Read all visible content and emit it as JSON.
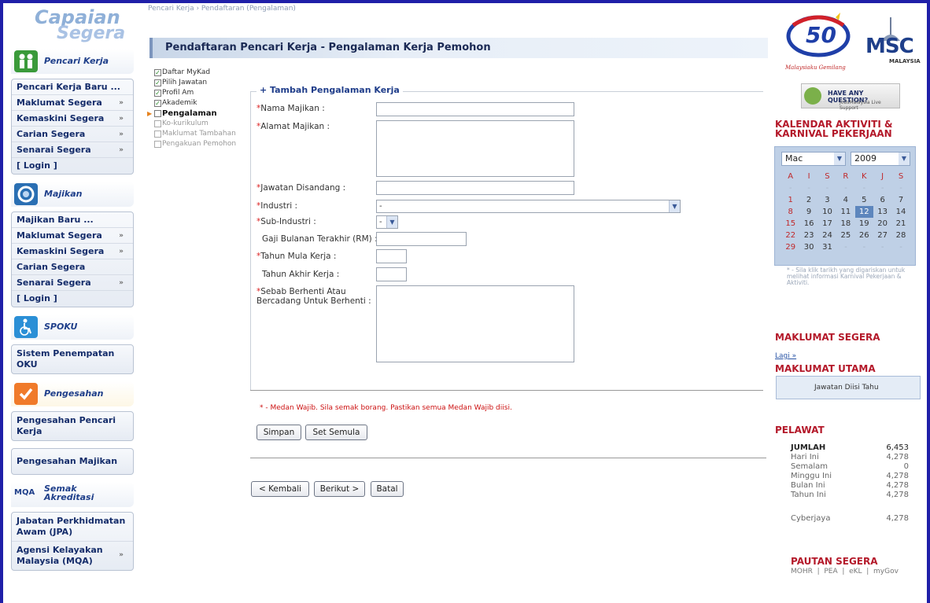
{
  "brand": {
    "logo_line1": "Capaian",
    "logo_line2": "Segera"
  },
  "breadcrumb": "Pencari Kerja › Pendaftaran (Pengalaman)",
  "page_title": "Pendaftaran Pencari Kerja - Pengalaman Kerja Pemohon",
  "sections": {
    "pencari": {
      "title": "Pencari Kerja",
      "items": [
        "Pencari Kerja Baru ...",
        "Maklumat Segera",
        "Kemaskini Segera",
        "Carian Segera",
        "Senarai Segera",
        "[ Login ]"
      ]
    },
    "majikan": {
      "title": "Majikan",
      "items": [
        "Majikan Baru ...",
        "Maklumat Segera",
        "Kemaskini Segera",
        "Carian Segera",
        "Senarai Segera",
        "[ Login ]"
      ]
    },
    "spoku": {
      "title": "SPOKU",
      "items": [
        "Sistem Penempatan OKU"
      ]
    },
    "pengesahan": {
      "title": "Pengesahan",
      "items": [
        "Pengesahan Pencari Kerja",
        "Pengesahan Majikan"
      ]
    },
    "semak": {
      "title_line1": "Semak",
      "title_line2": "Akreditasi",
      "logo": "MQA",
      "items": [
        "Jabatan Perkhidmatan Awam (JPA)",
        "Agensi Kelayakan Malaysia (MQA)"
      ]
    }
  },
  "arrow_glyph": "»",
  "steps": [
    "Daftar MyKad",
    "Pilih Jawatan",
    "Profil Am",
    "Akademik",
    "Pengalaman",
    "Ko-kurikulum",
    "Maklumat Tambahan",
    "Pengakuan Pemohon"
  ],
  "form": {
    "legend": "+ Tambah Pengalaman Kerja",
    "required_mark": "*",
    "nama_majikan": "Nama Majikan :",
    "alamat_majikan": "Alamat Majikan :",
    "jawatan": "Jawatan Disandang :",
    "industri": "Industri :",
    "industri_value": "-",
    "sub_industri": "Sub-Industri :",
    "sub_industri_value": "-",
    "gaji": "Gaji Bulanan Terakhir (RM) :",
    "tahun_mula": "Tahun Mula Kerja :",
    "tahun_akhir": "Tahun Akhir Kerja :",
    "sebab_1": "Sebab Berhenti Atau",
    "sebab_2": "Bercadang Untuk Berhenti :",
    "note": "* - Medan Wajib. Sila semak borang. Pastikan semua Medan Wajib diisi.",
    "simpan": "Simpan",
    "set_semula": "Set Semula"
  },
  "nav_buttons": {
    "kembali": "< Kembali",
    "berikut": "Berikut >",
    "batal": "Batal"
  },
  "right": {
    "logo_50": "50",
    "logo_tag": "Malaysiaku Gemilang",
    "msc": "MSC",
    "msc_sub": "MALAYSIA",
    "question_title": "HAVE ANY QUESTION?",
    "question_sub": "JobsMalaysia Live Support",
    "kalendar_1": "KALENDAR AKTIVITI &",
    "kalendar_2": "KARNIVAL PEKERJAAN",
    "cal_month": "Mac",
    "cal_year": "2009",
    "cal_days": [
      "A",
      "I",
      "S",
      "R",
      "K",
      "J",
      "S"
    ],
    "cal_rows": [
      [
        "-",
        "-",
        "-",
        "-",
        "-",
        "-",
        "-"
      ],
      [
        "1",
        "2",
        "3",
        "4",
        "5",
        "6",
        "7"
      ],
      [
        "8",
        "9",
        "10",
        "11",
        "12",
        "13",
        "14"
      ],
      [
        "15",
        "16",
        "17",
        "18",
        "19",
        "20",
        "21"
      ],
      [
        "22",
        "23",
        "24",
        "25",
        "26",
        "27",
        "28"
      ],
      [
        "29",
        "30",
        "31",
        "-",
        "-",
        "-",
        "-"
      ]
    ],
    "cal_today": "12",
    "cal_note": "* - Sila klik tarikh yang digariskan untuk melihat informasi Karnival Pekerjaan & Aktiviti.",
    "maklumat_segera": "MAKLUMAT SEGERA",
    "lagi": "Lagi »",
    "maklumat_utama": "MAKLUMAT UTAMA",
    "maklumat_utama_text": "Jawatan Diisi Tahu",
    "pelawat": "PELAWAT",
    "stats": [
      {
        "k": "JUMLAH",
        "v": "6,453"
      },
      {
        "k": "Hari Ini",
        "v": "4,278"
      },
      {
        "k": "Semalam",
        "v": "0"
      },
      {
        "k": "Minggu Ini",
        "v": "4,278"
      },
      {
        "k": "Bulan Ini",
        "v": "4,278"
      },
      {
        "k": "Tahun Ini",
        "v": "4,278"
      },
      {
        "k": "Cyberjaya",
        "v": "4,278"
      }
    ],
    "pautan": "PAUTAN SEGERA",
    "pautan_links": "MOHR  |  PEA  |  eKL  |  myGov"
  }
}
